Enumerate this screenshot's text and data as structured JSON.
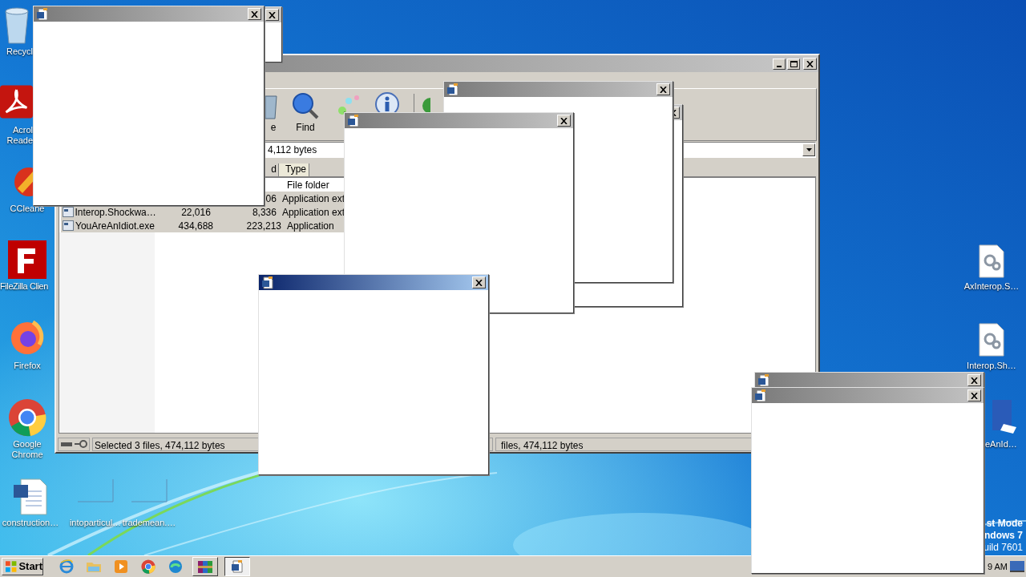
{
  "desktop_icons": [
    {
      "kind": "recycle",
      "label": "Recycl"
    },
    {
      "kind": "acrobat",
      "label": "Acrol Reade"
    },
    {
      "kind": "ccleaner",
      "label": "CCleane"
    },
    {
      "kind": "filezilla",
      "label": "FileZilla Clien"
    },
    {
      "kind": "firefox",
      "label": "Firefox"
    },
    {
      "kind": "chrome",
      "label": "Google Chrome"
    },
    {
      "kind": "worddoc",
      "label": "construction…"
    },
    {
      "kind": "blank",
      "label": "intoparticul…"
    },
    {
      "kind": "blank",
      "label": "trademean.…"
    },
    {
      "kind": "gears",
      "label": "AxInterop.S…"
    },
    {
      "kind": "gears",
      "label": "Interop.Sh…"
    },
    {
      "kind": "word",
      "label": "eAnId…"
    }
  ],
  "archiver": {
    "toolbar": [
      {
        "kind": "delete",
        "label": "e"
      },
      {
        "kind": "find",
        "label": "Find"
      },
      {
        "kind": "wizard"
      },
      {
        "kind": "info"
      },
      {
        "kind": "virus"
      }
    ],
    "address": "4,112 bytes",
    "columns": [
      "d",
      "Type"
    ],
    "rows": [
      {
        "type": "File folder",
        "selected": false
      },
      {
        "packed": "06",
        "type": "Application ext",
        "selected": true
      },
      {
        "name": "Interop.Shockwa…",
        "size": "22,016",
        "packed": "8,336",
        "type": "Application ext",
        "selected": true
      },
      {
        "name": "YouAreAnIdiot.exe",
        "size": "434,688",
        "packed": "223,213",
        "type": "Application",
        "selected": true
      }
    ],
    "status": [
      "Selected 3 files, 474,112 bytes",
      "files, 474,112 bytes"
    ]
  },
  "popups": [
    {
      "active": false
    },
    {
      "active": false
    },
    {
      "active": false
    },
    {
      "active": false
    },
    {
      "active": false
    },
    {
      "active": true
    },
    {
      "active": false
    },
    {
      "active": false
    }
  ],
  "taskbar": {
    "start": "Start",
    "buttons": [
      {
        "kind": "ie",
        "running": false,
        "selected": false
      },
      {
        "kind": "explorer",
        "running": false,
        "selected": false
      },
      {
        "kind": "media",
        "running": false,
        "selected": false
      },
      {
        "kind": "chrome",
        "running": false,
        "selected": false
      },
      {
        "kind": "edge",
        "running": false,
        "selected": false
      },
      {
        "kind": "winrar",
        "running": true,
        "selected": false
      },
      {
        "kind": "word",
        "running": true,
        "selected": true
      }
    ],
    "clock": "9 AM"
  },
  "test_mode": [
    "st Mode",
    "ndows 7",
    "uild 7601"
  ]
}
